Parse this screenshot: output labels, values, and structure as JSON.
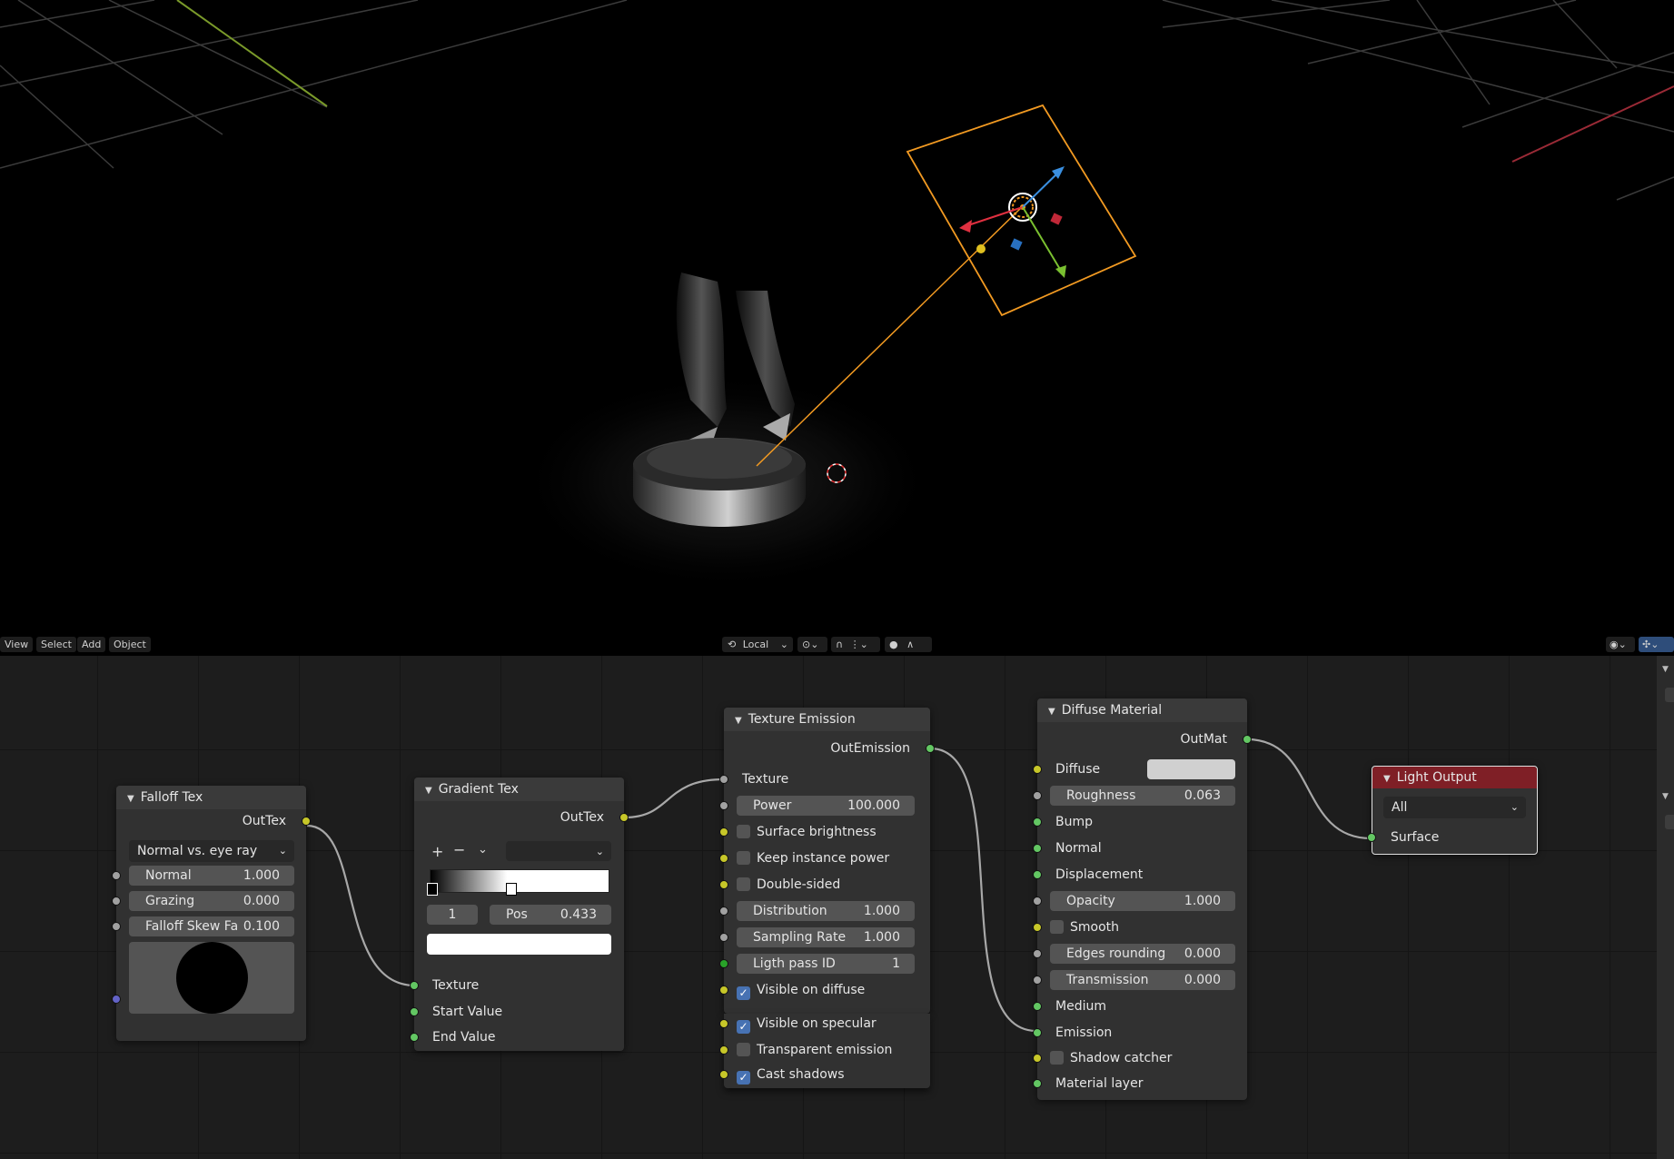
{
  "viewport": {
    "menu": [
      "View",
      "Select",
      "Add",
      "Object"
    ],
    "transform_orientation": "Local"
  },
  "nodes": {
    "falloff": {
      "title": "Falloff Tex",
      "output": "OutTex",
      "mode": "Normal vs. eye ray",
      "fields": [
        {
          "label": "Normal",
          "value": "1.000"
        },
        {
          "label": "Grazing",
          "value": "0.000"
        },
        {
          "label": "Falloff Skew Fa",
          "value": "0.100"
        }
      ]
    },
    "gradient": {
      "title": "Gradient Tex",
      "output": "OutTex",
      "index": "1",
      "pos_label": "Pos",
      "pos_value": "0.433",
      "inputs": [
        "Texture",
        "Start Value",
        "End Value"
      ]
    },
    "emission": {
      "title": "Texture Emission",
      "output": "OutEmission",
      "texture": "Texture",
      "power_label": "Power",
      "power_value": "100.000",
      "surface_brightness": "Surface brightness",
      "keep_instance_power": "Keep instance power",
      "double_sided": "Double-sided",
      "distribution_label": "Distribution",
      "distribution_value": "1.000",
      "sampling_rate_label": "Sampling Rate",
      "sampling_rate_value": "1.000",
      "pass_id_label": "Ligth pass ID",
      "pass_id_value": "1",
      "visible_on_diffuse": "Visible on diffuse",
      "visible_on_specular": "Visible on specular",
      "transparent_emission": "Transparent emission",
      "cast_shadows": "Cast shadows"
    },
    "diffuse": {
      "title": "Diffuse Material",
      "output": "OutMat",
      "diffuse": "Diffuse",
      "diffuse_color": "#d0d0d0",
      "roughness_label": "Roughness",
      "roughness_value": "0.063",
      "bump": "Bump",
      "normal": "Normal",
      "displacement": "Displacement",
      "opacity_label": "Opacity",
      "opacity_value": "1.000",
      "smooth": "Smooth",
      "edges_label": "Edges rounding",
      "edges_value": "0.000",
      "transmission_label": "Transmission",
      "transmission_value": "0.000",
      "medium": "Medium",
      "emission": "Emission",
      "shadow_catcher": "Shadow catcher",
      "material_layer": "Material layer"
    },
    "light_output": {
      "title": "Light Output",
      "mode": "All",
      "input": "Surface",
      "header_color": "#7f1f26"
    }
  },
  "colors": {
    "selection_orange": "#f29a22",
    "socket_yellow": "#c7c729",
    "socket_green": "#63c763",
    "socket_grey": "#a1a1a1",
    "checkbox_blue": "#4772b3"
  }
}
